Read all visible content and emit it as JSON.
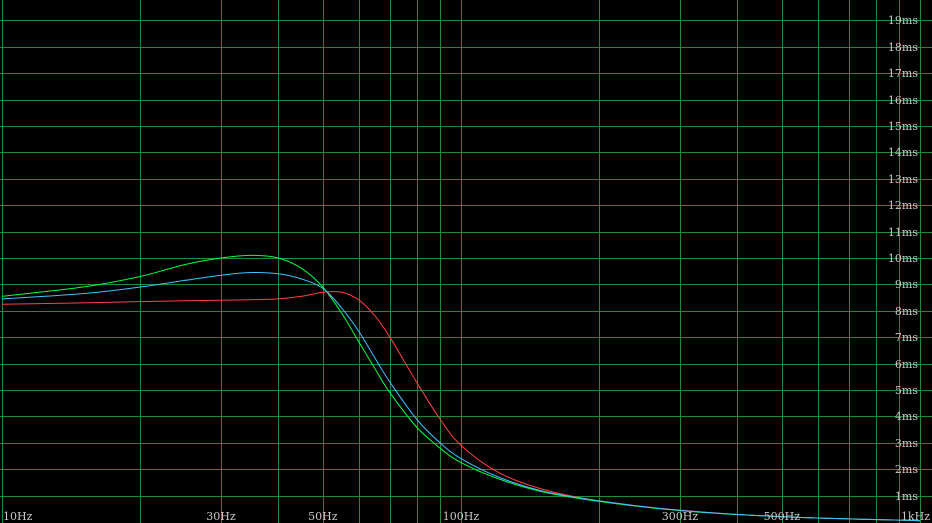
{
  "chart_data": {
    "type": "line",
    "title": "",
    "xlabel": "",
    "ylabel": "",
    "x_scale": "log",
    "xlim": [
      10,
      1000
    ],
    "ylim": [
      0,
      20
    ],
    "grid": true,
    "background_color": "#000000",
    "grid_color": "#1e8c3c",
    "text_color": "#c8c8c8",
    "x_ticks": [
      {
        "value": 10,
        "label": "10Hz"
      },
      {
        "value": 30,
        "label": "30Hz"
      },
      {
        "value": 50,
        "label": "50Hz"
      },
      {
        "value": 100,
        "label": "100Hz"
      },
      {
        "value": 300,
        "label": "300Hz"
      },
      {
        "value": 500,
        "label": "500Hz"
      },
      {
        "value": 1000,
        "label": "1kHz"
      }
    ],
    "x_grid_values": [
      10,
      20,
      30,
      40,
      50,
      60,
      70,
      80,
      90,
      100,
      200,
      300,
      400,
      500,
      600,
      700,
      800,
      900,
      1000
    ],
    "y_ticks": [
      {
        "value": 1,
        "label": "1ms"
      },
      {
        "value": 2,
        "label": "2ms"
      },
      {
        "value": 3,
        "label": "3ms"
      },
      {
        "value": 4,
        "label": "4ms"
      },
      {
        "value": 5,
        "label": "5ms"
      },
      {
        "value": 6,
        "label": "6ms"
      },
      {
        "value": 7,
        "label": "7ms"
      },
      {
        "value": 8,
        "label": "8ms"
      },
      {
        "value": 9,
        "label": "9ms"
      },
      {
        "value": 10,
        "label": "10ms"
      },
      {
        "value": 11,
        "label": "11ms"
      },
      {
        "value": 12,
        "label": "12ms"
      },
      {
        "value": 13,
        "label": "13ms"
      },
      {
        "value": 14,
        "label": "14ms"
      },
      {
        "value": 15,
        "label": "15ms"
      },
      {
        "value": 16,
        "label": "16ms"
      },
      {
        "value": 17,
        "label": "17ms"
      },
      {
        "value": 18,
        "label": "18ms"
      },
      {
        "value": 19,
        "label": "19ms"
      }
    ],
    "x": [
      10,
      15,
      20,
      25,
      30,
      35,
      40,
      45,
      50,
      55,
      60,
      65,
      70,
      80,
      90,
      100,
      120,
      150,
      200,
      300,
      500,
      1000
    ],
    "series": [
      {
        "color": "#ff4040",
        "values": [
          8.25,
          8.3,
          8.35,
          8.38,
          8.4,
          8.42,
          8.45,
          8.55,
          8.7,
          8.7,
          8.4,
          7.8,
          7.0,
          5.3,
          3.9,
          2.9,
          1.9,
          1.25,
          0.8,
          0.45,
          0.2,
          0.05
        ]
      },
      {
        "color": "#00ff40",
        "values": [
          8.55,
          8.9,
          9.3,
          9.75,
          10.0,
          10.1,
          10.0,
          9.6,
          8.9,
          7.9,
          6.8,
          5.8,
          4.9,
          3.6,
          2.8,
          2.25,
          1.65,
          1.15,
          0.78,
          0.43,
          0.2,
          0.05
        ]
      },
      {
        "color": "#40c0ff",
        "values": [
          8.45,
          8.65,
          8.9,
          9.15,
          9.35,
          9.45,
          9.4,
          9.2,
          8.85,
          8.1,
          7.2,
          6.2,
          5.3,
          3.9,
          3.0,
          2.4,
          1.72,
          1.18,
          0.8,
          0.44,
          0.2,
          0.05
        ]
      }
    ]
  }
}
